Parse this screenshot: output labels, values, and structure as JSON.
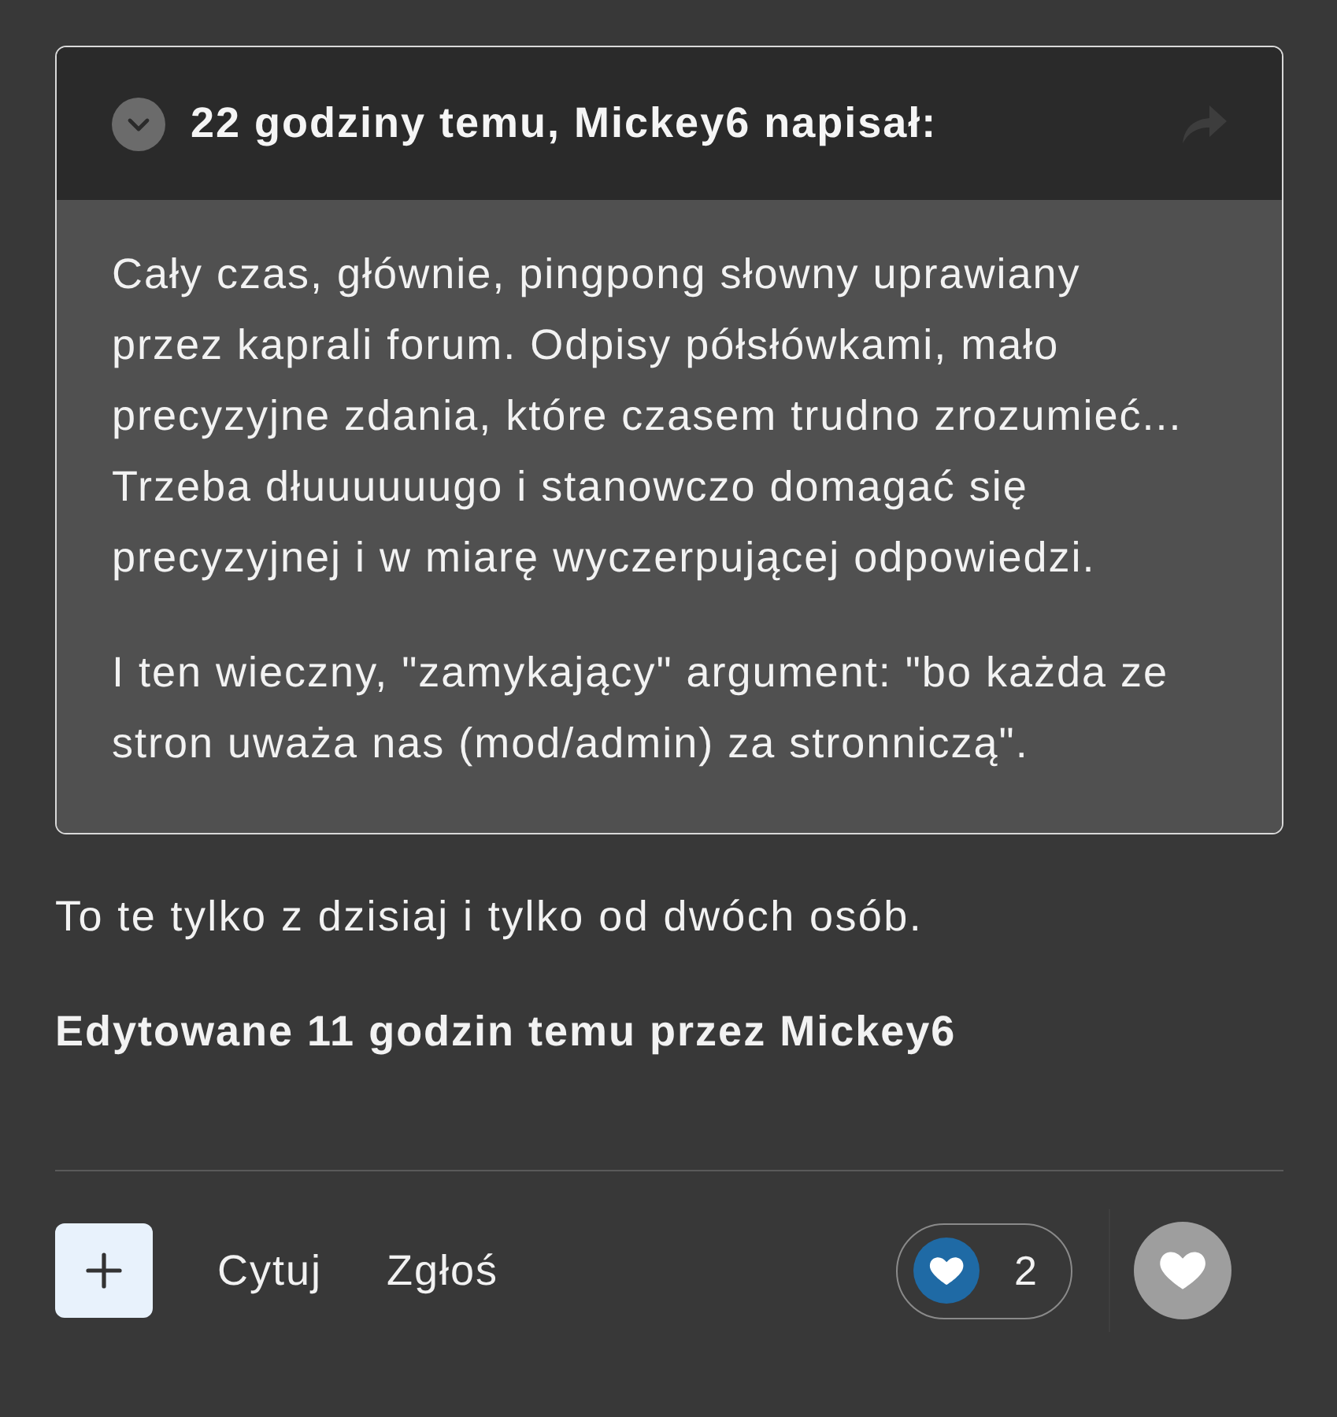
{
  "quote": {
    "header": "22 godziny temu, Mickey6 napisał:",
    "paragraphs": [
      "Cały czas, głównie, pingpong słowny uprawiany przez kaprali forum. Odpisy półsłówkami, mało precyzyjne zdania, które czasem trudno zrozumieć... Trzeba dłuuuuuugo i stanowczo domagać się precyzyjnej i w miarę wyczerpującej odpowiedzi.",
      "I ten wieczny, \"zamykający\" argument: \"bo każda ze stron uważa nas (mod/admin) za stronniczą\"."
    ]
  },
  "post": {
    "paragraphs": [
      "To te tylko z dzisiaj i tylko od dwóch osób."
    ],
    "edit_note": "Edytowane 11 godzin temu przez Mickey6"
  },
  "footer": {
    "actions": [
      "Cytuj",
      "Zgłoś"
    ],
    "reaction_count": "2"
  }
}
